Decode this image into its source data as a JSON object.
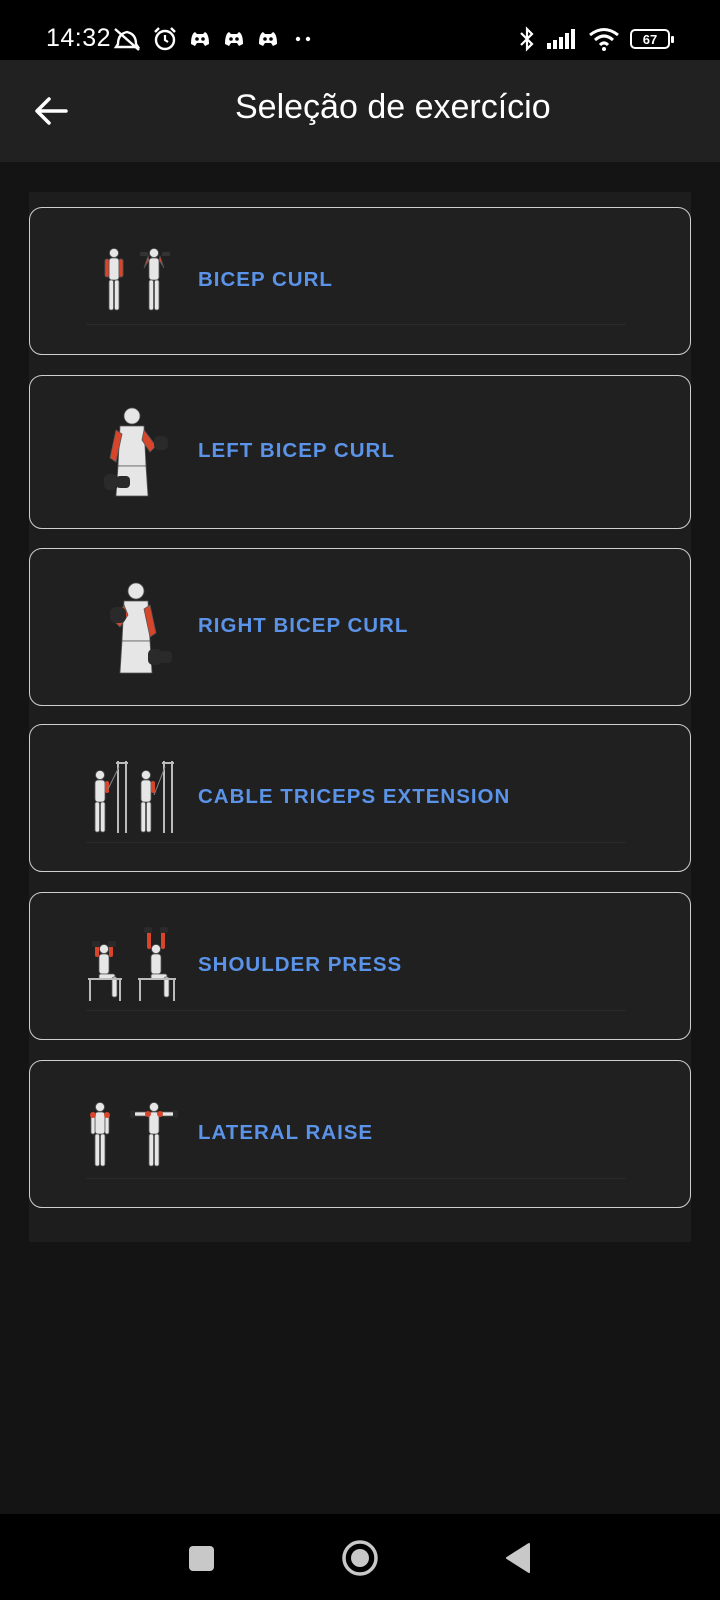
{
  "status_bar": {
    "time": "14:32",
    "battery_level": "67",
    "icons": [
      "muted-alarm-icon",
      "alarm-clock-icon",
      "discord-icon",
      "discord-icon",
      "discord-icon",
      "more-dots-icon",
      "bluetooth-icon",
      "signal-icon",
      "wifi-icon",
      "battery-icon"
    ]
  },
  "app_bar": {
    "title": "Seleção de exercício",
    "back_icon": "arrow-left-icon"
  },
  "exercises": [
    {
      "label": "BICEP CURL",
      "thumb": "bicep-curl-illustration"
    },
    {
      "label": "LEFT BICEP CURL",
      "thumb": "left-bicep-curl-illustration"
    },
    {
      "label": "RIGHT BICEP CURL",
      "thumb": "right-bicep-curl-illustration"
    },
    {
      "label": "CABLE TRICEPS EXTENSION",
      "thumb": "cable-triceps-extension-illustration"
    },
    {
      "label": "SHOULDER PRESS",
      "thumb": "shoulder-press-illustration"
    },
    {
      "label": "LATERAL RAISE",
      "thumb": "lateral-raise-illustration"
    }
  ],
  "colors": {
    "accent": "#5b93e8",
    "muscle_highlight": "#d9452b",
    "background": "#141414",
    "card": "#202020",
    "app_bar": "#212121"
  },
  "nav_bar": {
    "icons": [
      "recents-square-icon",
      "home-circle-icon",
      "back-triangle-icon"
    ]
  }
}
